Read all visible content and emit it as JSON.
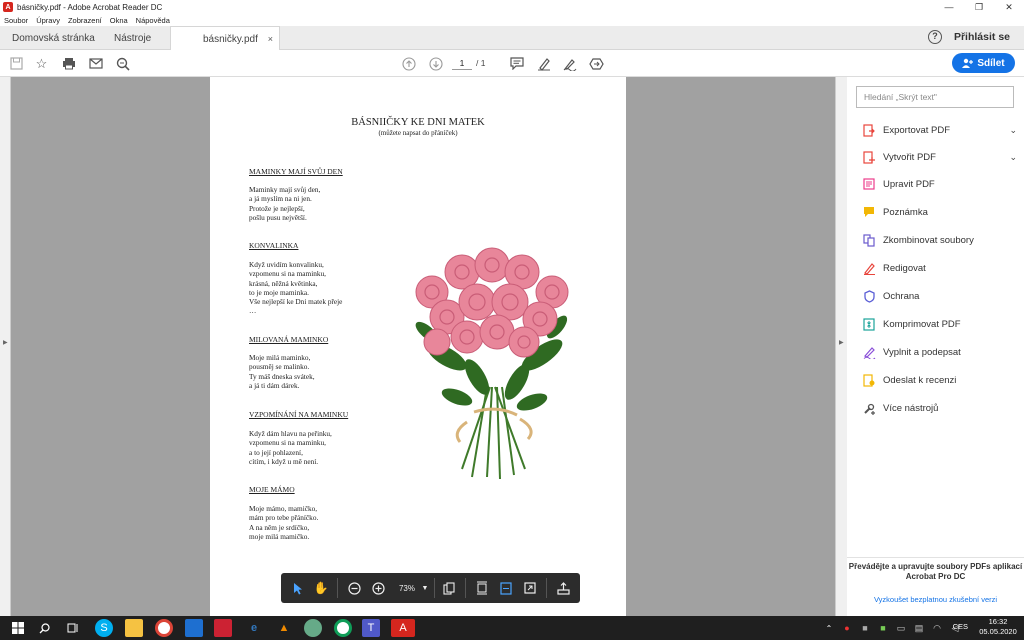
{
  "window": {
    "title": "básničky.pdf - Adobe Acrobat Reader DC",
    "minimize": "—",
    "maximize": "❐",
    "close": "✕"
  },
  "menu": [
    "Soubor",
    "Úpravy",
    "Zobrazení",
    "Okna",
    "Nápověda"
  ],
  "tabs": {
    "home": "Domovská stránka",
    "tools": "Nástroje",
    "doc": "básničky.pdf",
    "doc_close": "×"
  },
  "header": {
    "help": "?",
    "signin": "Přihlásit se"
  },
  "toolbar": {
    "page_current": "1",
    "page_total": "/ 1",
    "share": "Sdílet"
  },
  "document": {
    "title": "BÁSNIIČKY KE DNI MATEK",
    "subtitle": "(můžete napsat do přáníček)",
    "poems": [
      {
        "heading": "MAMINKY MAJÍ SVŮJ DEN",
        "lines": [
          "Maminky mají svůj den,",
          "a já myslím na ni jen.",
          "Protože je nejlepší,",
          "pošlu pusu největší."
        ]
      },
      {
        "heading": "KONVALINKA",
        "lines": [
          "Když uvidím konvalinku,",
          "vzpomenu si na maminku,",
          "krásná, něžná květinka,",
          "to je moje maminka.",
          "Vše nejlepší ke Dni matek přeje",
          "…"
        ]
      },
      {
        "heading": "MILOVANÁ MAMINKO",
        "lines": [
          "Moje milá maminko,",
          "pousměj se malinko.",
          "Ty máš dneska svátek,",
          "a já ti dám dárek."
        ]
      },
      {
        "heading": "VZPOMÍNÁNÍ NA MAMINKU",
        "lines": [
          "Když dám hlavu na peřinku,",
          "vzpomenu si na maminku,",
          "a to její pohlazení,",
          "cítím, i když u mě není."
        ]
      },
      {
        "heading": "MOJE MÁMO",
        "lines": [
          "Moje mámo, mamičko,",
          "mám pro tebe přáníčko.",
          "A na něm je srdíčko,",
          "moje milá mamičko."
        ]
      }
    ]
  },
  "floatbar": {
    "zoom": "73%"
  },
  "rightpanel": {
    "search_placeholder": "Hledání „Skrýt text\"",
    "items": [
      {
        "label": "Exportovat PDF",
        "color": "#e8453c"
      },
      {
        "label": "Vytvořit PDF",
        "color": "#e8453c"
      },
      {
        "label": "Upravit PDF",
        "color": "#ec3c8b"
      },
      {
        "label": "Poznámka",
        "color": "#f2b705"
      },
      {
        "label": "Zkombinovat soubory",
        "color": "#6a5acd"
      },
      {
        "label": "Redigovat",
        "color": "#e8453c"
      },
      {
        "label": "Ochrana",
        "color": "#5b5fd6"
      },
      {
        "label": "Komprimovat PDF",
        "color": "#1aa39a"
      },
      {
        "label": "Vyplnit a podepsat",
        "color": "#8a4fd8"
      },
      {
        "label": "Odeslat k recenzi",
        "color": "#f2b705"
      },
      {
        "label": "Více nástrojů",
        "color": "#555555"
      }
    ],
    "promo": "Převádějte a upravujte soubory PDFs aplikací Acrobat Pro DC",
    "trial": "Vyzkoušet bezplatnou zkušební verzi"
  },
  "taskbar": {
    "lang": "CES",
    "time": "16:32",
    "date": "05.05.2020"
  }
}
